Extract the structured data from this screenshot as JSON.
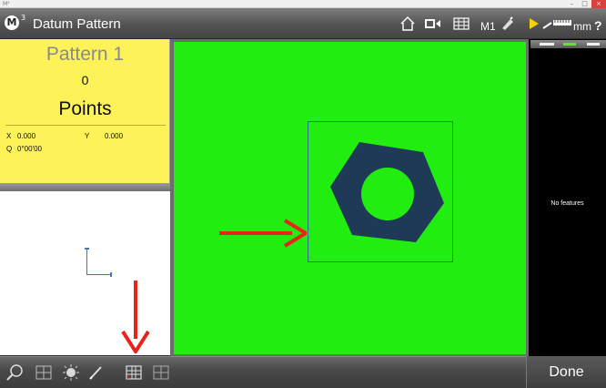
{
  "window": {
    "os_icon": "M³",
    "min_symbol": "–",
    "max_symbol": "□",
    "close_symbol": "×"
  },
  "header": {
    "logo_letter": "M",
    "logo_superscript": "3",
    "title": "Datum Pattern",
    "toolbar_icons": [
      "home-icon",
      "video-icon",
      "grid-icon",
      "m1-label",
      "probe-icon",
      "play-icon",
      "ruler-icon",
      "help-icon"
    ],
    "m1_label": "M1",
    "units_label": "mm",
    "help_label": "?"
  },
  "pattern_panel": {
    "title": "Pattern 1",
    "count": "0",
    "unit": "Points",
    "x_label": "X",
    "x_value": "0.000",
    "y_label": "Y",
    "y_value": "0.000",
    "q_label": "Q",
    "q_value": "0°00'00"
  },
  "features_panel": {
    "empty_text": "No features"
  },
  "bottom_toolbar": {
    "tools": [
      "magnifier-icon",
      "grid-icon",
      "light-icon",
      "pen-icon",
      "pattern-grid-icon",
      "grid-outline-icon"
    ],
    "done_label": "Done"
  },
  "colors": {
    "video_background": "#21ee10",
    "pattern_panel": "#fdf359",
    "arrow": "#e8231b",
    "nut": "#1f3a57",
    "axis": "#4b6bd6"
  }
}
